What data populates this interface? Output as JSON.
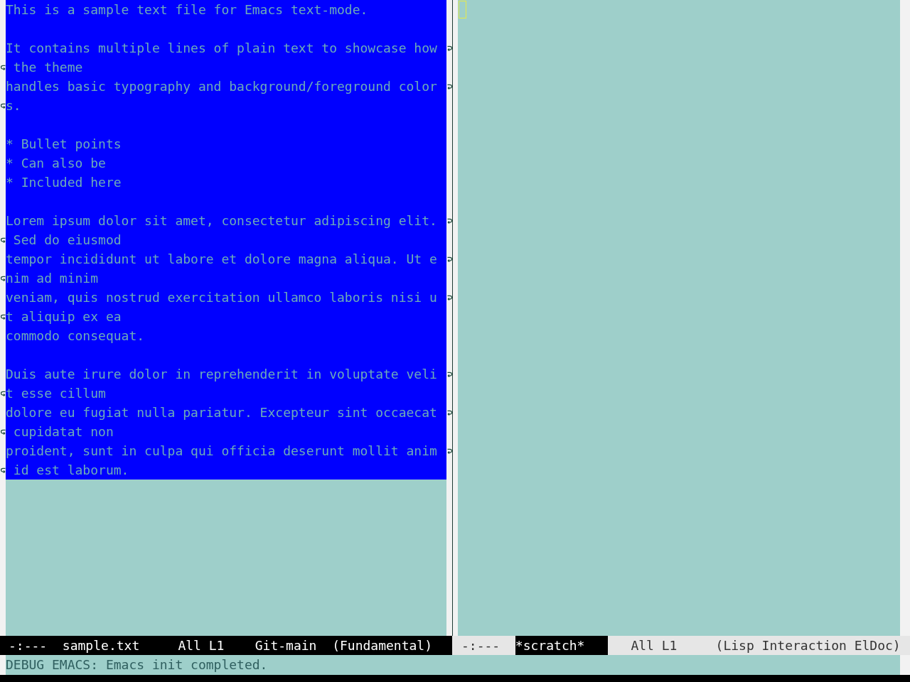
{
  "windows": [
    {
      "buffer": {
        "highlighted": true,
        "paragraphs": [
          {
            "lines": [
              {
                "rows": [
                  "This is a sample text file for Emacs text-mode."
                ]
              }
            ]
          },
          {
            "lines": [
              {
                "rows": [
                  "It contains multiple lines of plain text to showcase how",
                  " the theme"
                ]
              },
              {
                "rows": [
                  "handles basic typography and background/foreground color",
                  "s."
                ]
              }
            ]
          },
          {
            "lines": [
              {
                "rows": [
                  "* Bullet points"
                ]
              },
              {
                "rows": [
                  "* Can also be"
                ]
              },
              {
                "rows": [
                  "* Included here"
                ]
              }
            ]
          },
          {
            "lines": [
              {
                "rows": [
                  "Lorem ipsum dolor sit amet, consectetur adipiscing elit.",
                  " Sed do eiusmod"
                ]
              },
              {
                "rows": [
                  "tempor incididunt ut labore et dolore magna aliqua. Ut e",
                  "nim ad minim"
                ]
              },
              {
                "rows": [
                  "veniam, quis nostrud exercitation ullamco laboris nisi u",
                  "t aliquip ex ea"
                ]
              },
              {
                "rows": [
                  "commodo consequat."
                ]
              }
            ]
          },
          {
            "lines": [
              {
                "rows": [
                  "Duis aute irure dolor in reprehenderit in voluptate veli",
                  "t esse cillum"
                ]
              },
              {
                "rows": [
                  "dolore eu fugiat nulla pariatur. Excepteur sint occaecat",
                  " cupidatat non"
                ]
              },
              {
                "rows": [
                  "proident, sunt in culpa qui officia deserunt mollit anim",
                  " id est laborum."
                ]
              }
            ]
          }
        ]
      },
      "mode_line": {
        "active": true,
        "status": "-:---",
        "buffer_name": "sample.txt",
        "position": "All L1",
        "vc_branch": "Git-main",
        "modes": "(Fundamental)"
      }
    },
    {
      "cursor": {
        "hollow": true
      },
      "mode_line": {
        "active": false,
        "status": "-:---",
        "buffer_name": "*scratch*",
        "position": "All L1",
        "modes": "(Lisp Interaction ElDoc)"
      }
    }
  ],
  "echo_area": {
    "message": "DEBUG EMACS: Emacs init completed."
  }
}
